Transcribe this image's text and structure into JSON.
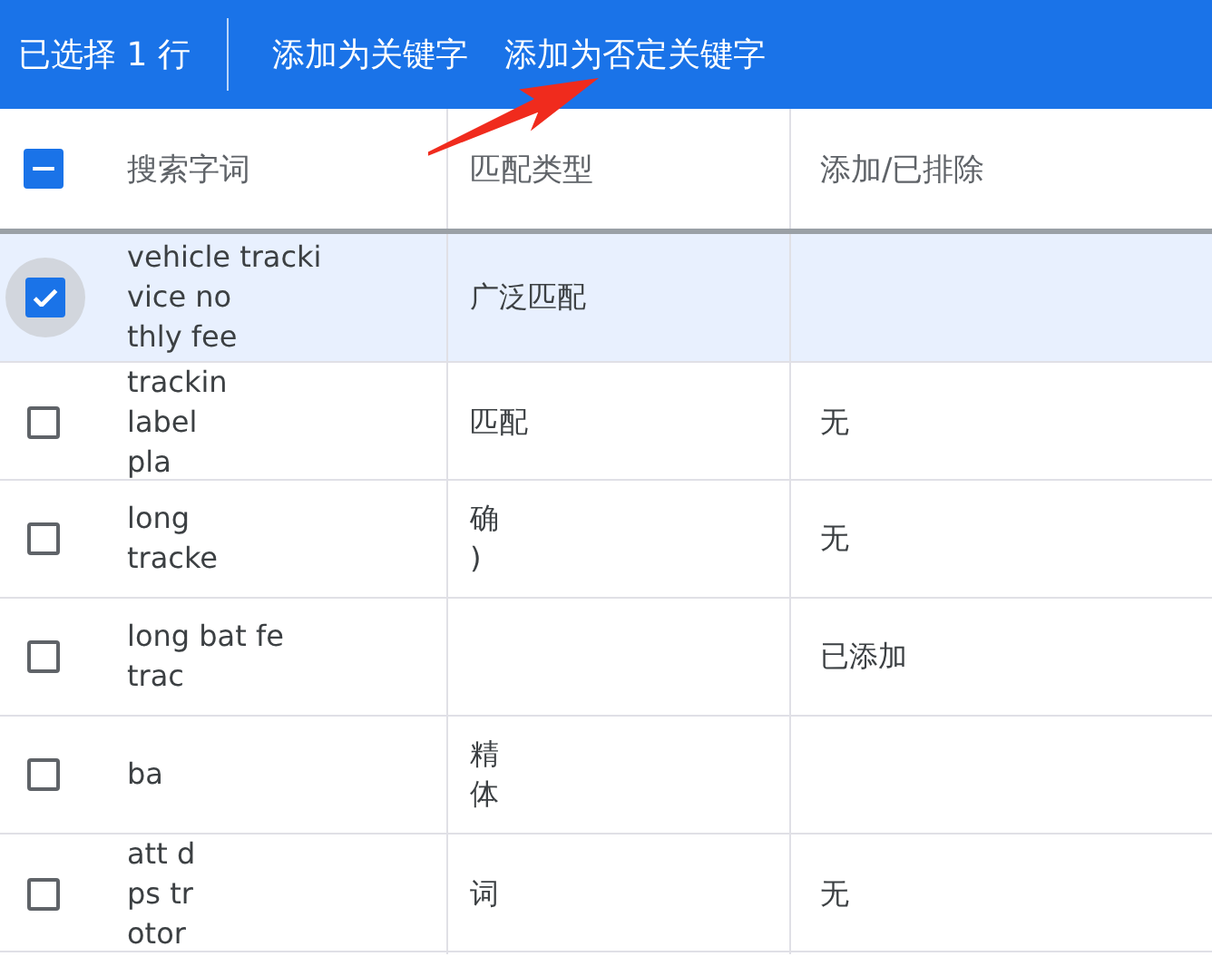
{
  "toolbar": {
    "selection_count": "已选择 1 行",
    "actions": [
      "添加为关键字",
      "添加为否定关键字"
    ]
  },
  "annotation": {
    "kind": "arrow"
  },
  "table": {
    "select_all": {
      "indeterminate": true
    },
    "columns": [
      "搜索字词",
      "匹配类型",
      "添加/已排除"
    ],
    "rows": [
      {
        "selected": true,
        "term": "vehicle tracki\nvice no\nthly fee",
        "match": [
          "广泛匹配"
        ]
      },
      {
        "selected": false,
        "term": "trackin\nlabel\npla",
        "match": [
          "匹配"
        ],
        "status": "无"
      },
      {
        "selected": false,
        "term": "long\ntracke",
        "match": [
          "确",
          ")"
        ],
        "status": "无"
      },
      {
        "selected": false,
        "term": "long bat fe\ntrac",
        "status": "已添加"
      },
      {
        "selected": false,
        "term": "ba",
        "match": [
          "精",
          "体"
        ]
      },
      {
        "selected": false,
        "term": "att d\nps tr\notor",
        "match": [
          "词"
        ],
        "status": "无"
      }
    ]
  }
}
